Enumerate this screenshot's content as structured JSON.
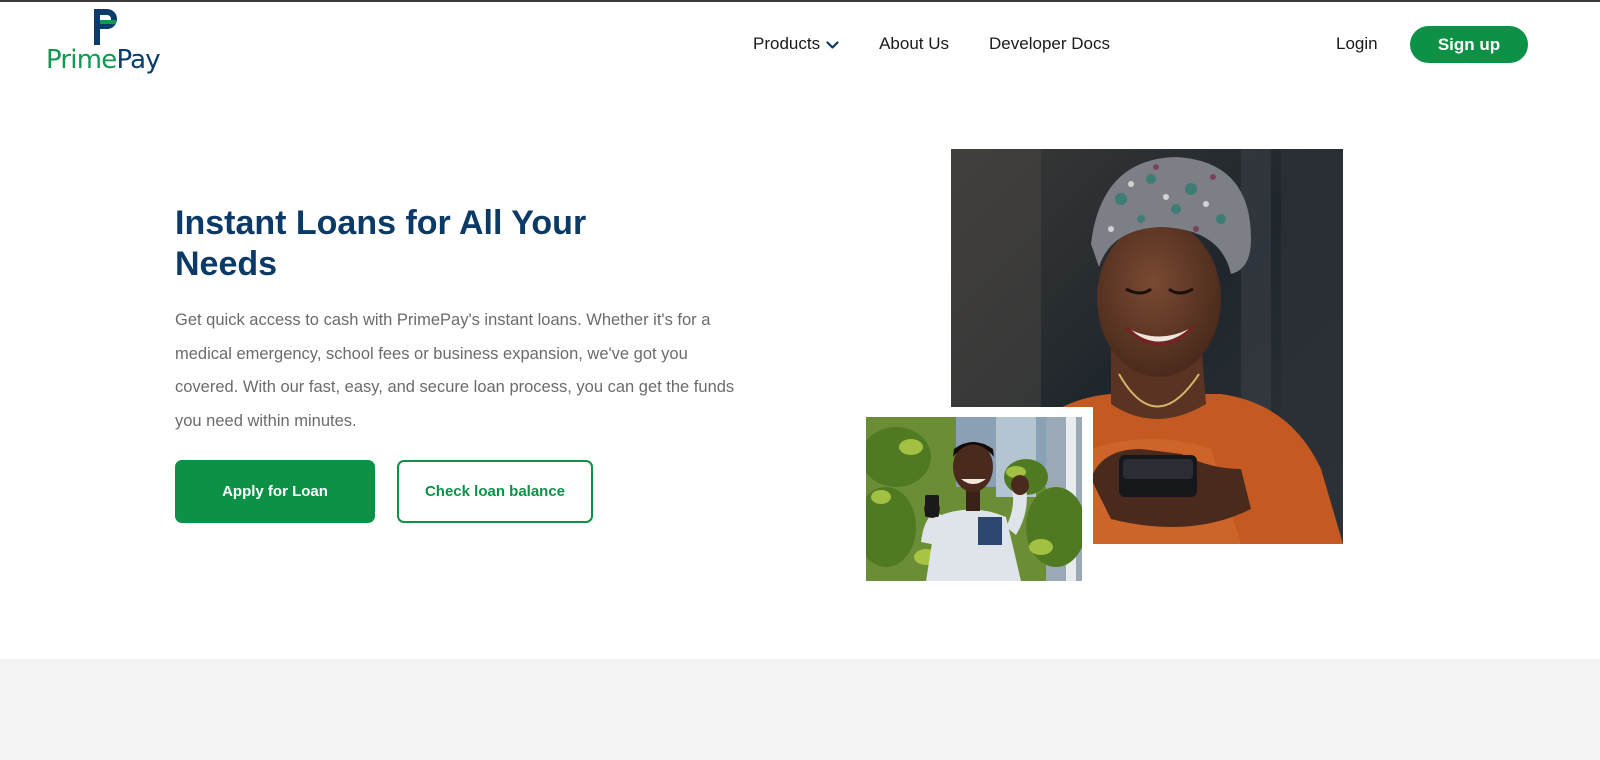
{
  "brand": {
    "name_part1": "Prime",
    "name_part2": "Pay",
    "colors": {
      "green": "#0d9146",
      "navy": "#0b3a67",
      "text_gray": "#6b6b6b"
    }
  },
  "nav": {
    "products": {
      "label": "Products",
      "icon": "chevron-down-icon"
    },
    "about": "About Us",
    "developer": "Developer Docs"
  },
  "auth": {
    "login": "Login",
    "signup": "Sign up"
  },
  "hero": {
    "title": "Instant Loans for All Your Needs",
    "description": "Get quick access to cash with PrimePay's instant loans. Whether it's for a medical emergency, school fees or business expansion, we've got you covered. With our fast, easy, and secure loan process, you can get the funds you need within minutes.",
    "apply_button": "Apply for Loan",
    "balance_button": "Check loan balance"
  }
}
